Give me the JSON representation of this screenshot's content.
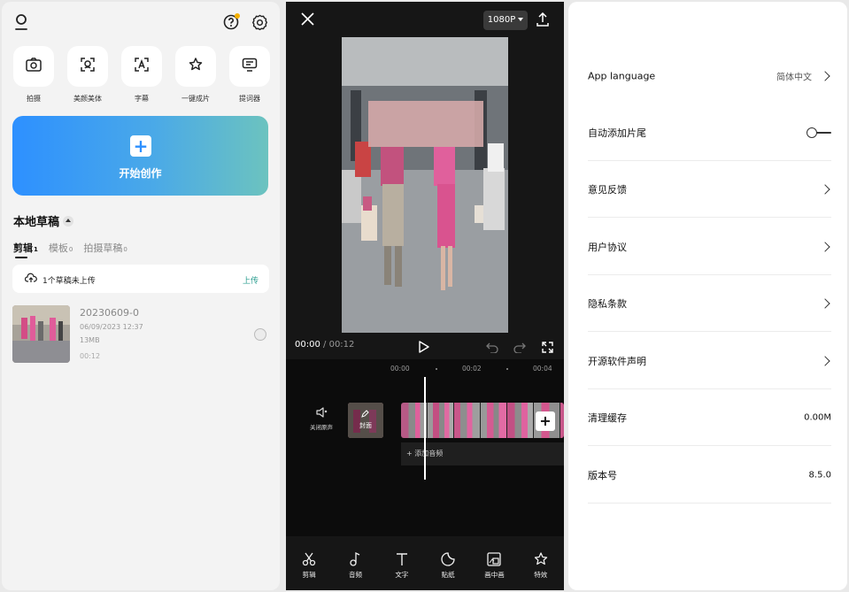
{
  "home": {
    "tools": [
      {
        "label": "拍摄",
        "icon": "camera-icon"
      },
      {
        "label": "美颜美体",
        "icon": "beauty-icon"
      },
      {
        "label": "字幕",
        "icon": "caption-icon"
      },
      {
        "label": "一键成片",
        "icon": "magic-icon"
      },
      {
        "label": "提词器",
        "icon": "teleprompter-icon"
      }
    ],
    "create_label": "开始创作",
    "drafts_title": "本地草稿",
    "tabs": [
      {
        "label": "剪辑",
        "count": "1"
      },
      {
        "label": "模板",
        "count": "0"
      },
      {
        "label": "拍摄草稿",
        "count": "0"
      }
    ],
    "upload_notice": "1个草稿未上传",
    "upload_action": "上传",
    "draft": {
      "name": "20230609-0",
      "date": "06/09/2023 12:37",
      "size": "13MB",
      "duration": "00:12"
    }
  },
  "editor": {
    "resolution": "1080P",
    "current_time": "00:00",
    "total_time": "00:12",
    "ruler": [
      "00:00",
      "00:02",
      "00:04"
    ],
    "mute_label": "关闭原声",
    "cover_label": "封面",
    "add_audio": "添加音频",
    "toolbar": [
      {
        "label": "剪辑",
        "icon": "scissors-icon"
      },
      {
        "label": "音频",
        "icon": "music-note-icon"
      },
      {
        "label": "文字",
        "icon": "text-icon"
      },
      {
        "label": "贴纸",
        "icon": "sticker-icon"
      },
      {
        "label": "画中画",
        "icon": "picture-in-picture-icon"
      },
      {
        "label": "特效",
        "icon": "effects-icon"
      }
    ]
  },
  "settings": {
    "rows": [
      {
        "label": "App language",
        "value": "简体中文"
      },
      {
        "label": "自动添加片尾",
        "toggle": false
      },
      {
        "label": "意见反馈"
      },
      {
        "label": "用户协议"
      },
      {
        "label": "隐私条款"
      },
      {
        "label": "开源软件声明"
      },
      {
        "label": "清理缓存",
        "value": "0.00M"
      },
      {
        "label": "版本号",
        "value": "8.5.0"
      }
    ]
  }
}
